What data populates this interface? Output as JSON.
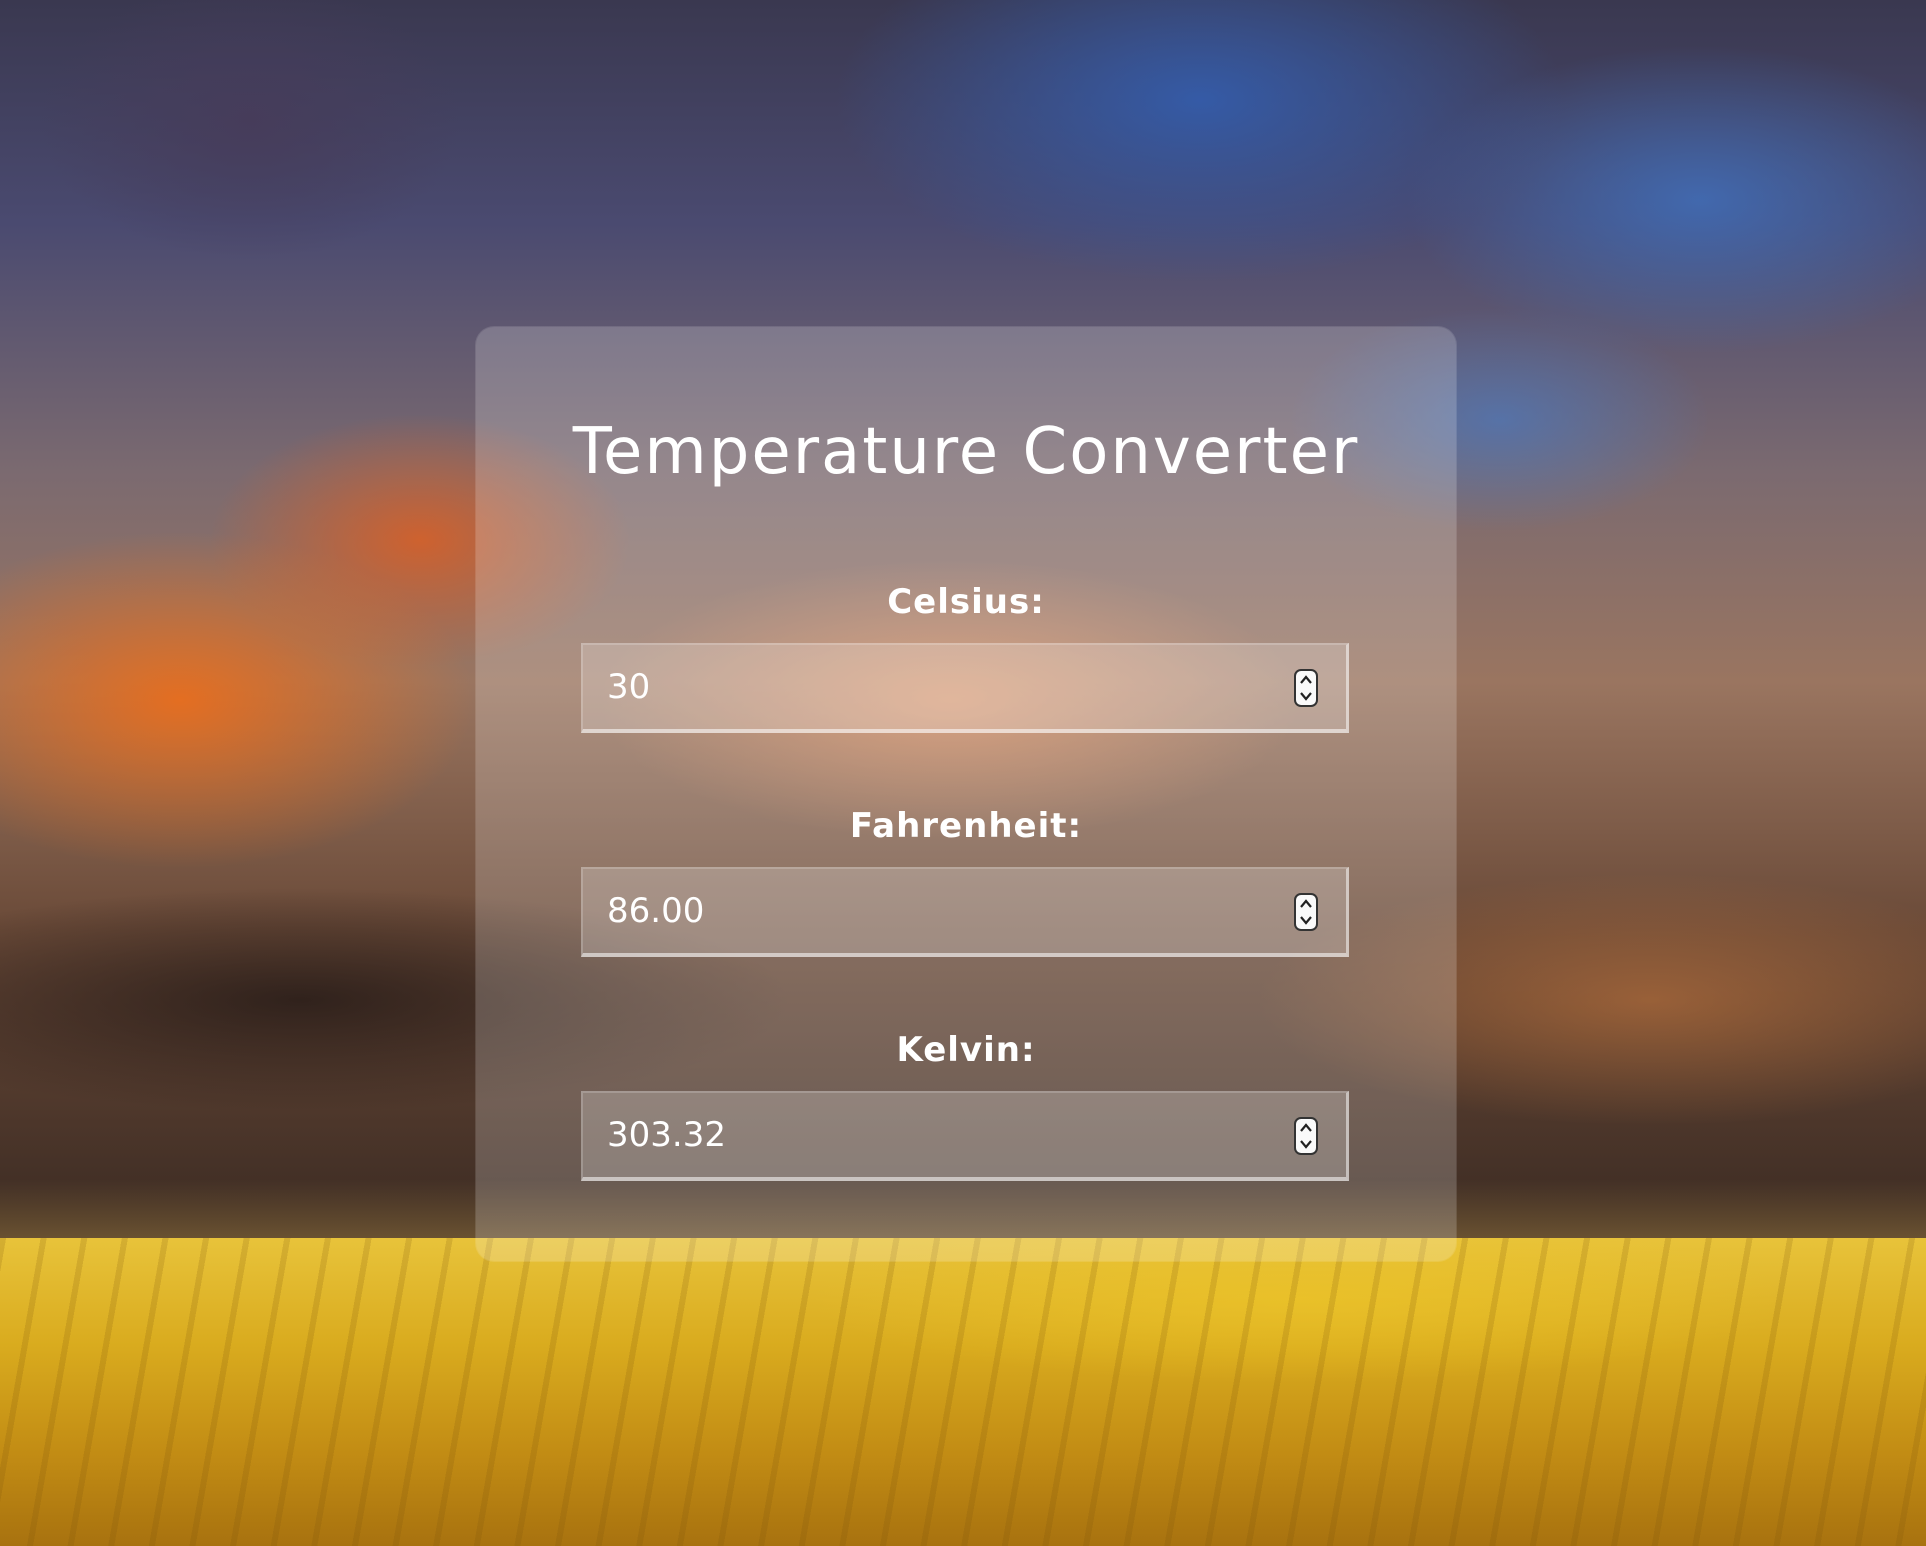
{
  "title": "Temperature Converter",
  "fields": [
    {
      "label": "Celsius:",
      "value": "30"
    },
    {
      "label": "Fahrenheit:",
      "value": "86.00"
    },
    {
      "label": "Kelvin:",
      "value": "303.32"
    }
  ],
  "icons": {
    "spinner_up": "chevron-up-icon",
    "spinner_down": "chevron-down-icon"
  },
  "colors": {
    "text": "#ffffff",
    "card_bg": "rgba(255,255,255,0.20)"
  }
}
